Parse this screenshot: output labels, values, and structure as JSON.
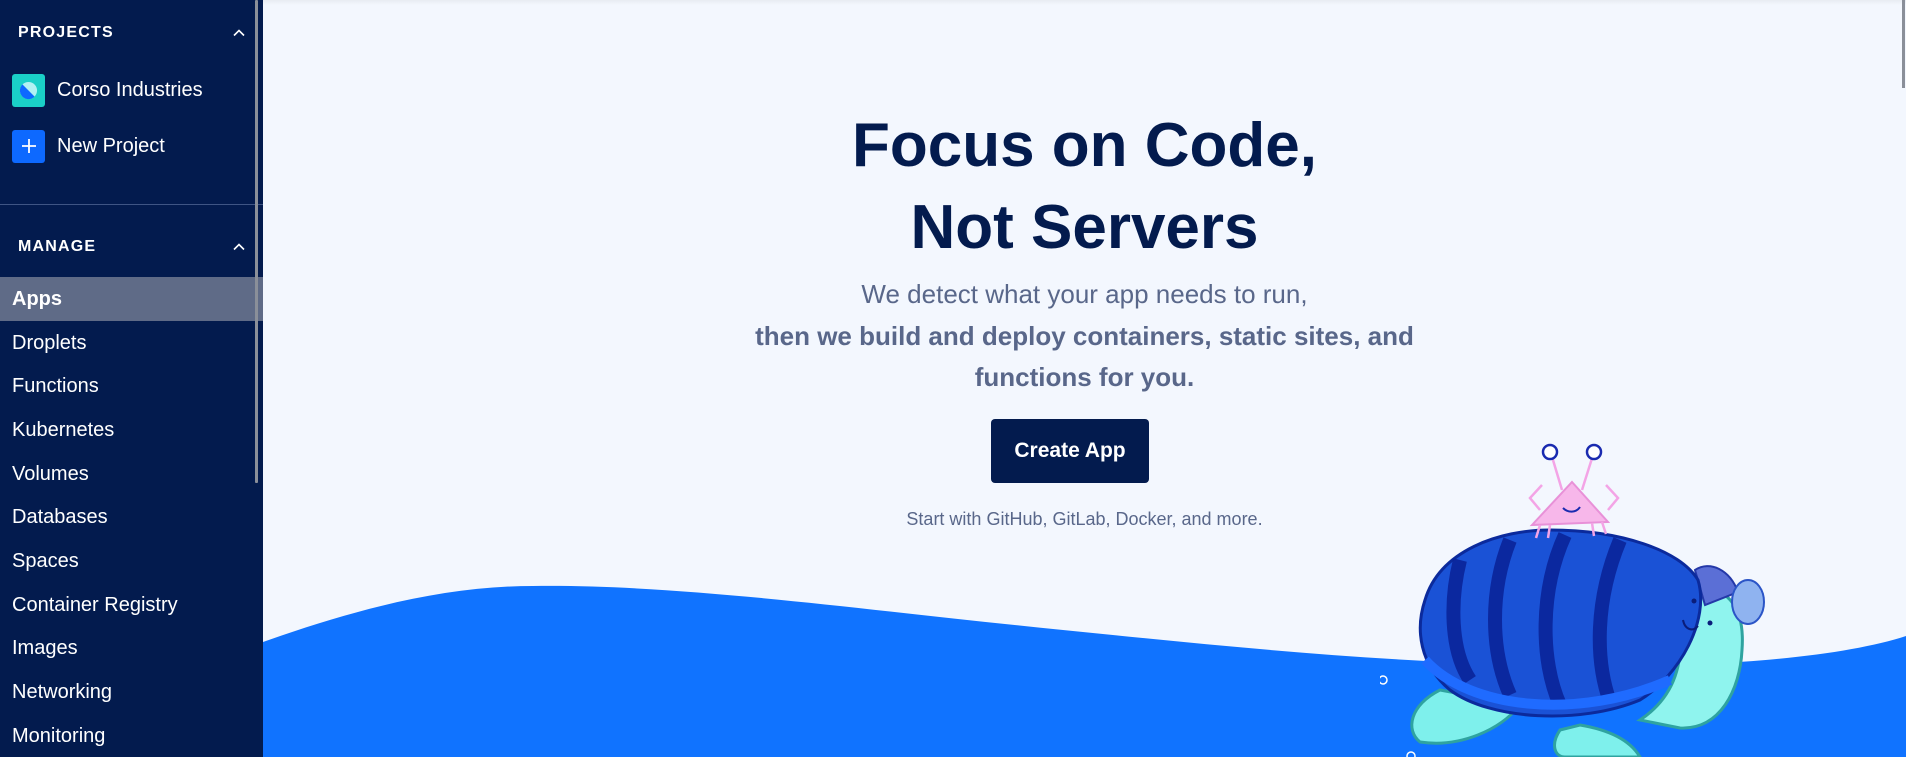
{
  "sidebar": {
    "projects_title": "PROJECTS",
    "projects": [
      {
        "label": "Corso Industries",
        "icon": "project-logo-icon",
        "icon_color": "#1ad0c8"
      },
      {
        "label": "New Project",
        "icon": "plus-icon",
        "icon_color": "#0d69ff"
      }
    ],
    "manage_title": "MANAGE",
    "nav_items": [
      {
        "label": "Apps",
        "active": true
      },
      {
        "label": "Droplets"
      },
      {
        "label": "Functions"
      },
      {
        "label": "Kubernetes"
      },
      {
        "label": "Volumes"
      },
      {
        "label": "Databases"
      },
      {
        "label": "Spaces"
      },
      {
        "label": "Container Registry"
      },
      {
        "label": "Images"
      },
      {
        "label": "Networking"
      },
      {
        "label": "Monitoring"
      }
    ]
  },
  "hero": {
    "headline_line1": "Focus on Code,",
    "headline_line2": "Not Servers",
    "subtitle_line1": "We detect what your app needs to run,",
    "subtitle_line2": "then we build and deploy containers, static sites, and",
    "subtitle_line3": "functions for you.",
    "cta_label": "Create App",
    "caption": "Start with GitHub, GitLab, Docker, and more."
  },
  "colors": {
    "sidebar_bg": "#031b4e",
    "active_item_bg": "#5f6b87",
    "primary_blue": "#1073ff",
    "navy": "#031b4e",
    "page_bg": "#f3f7fe"
  }
}
